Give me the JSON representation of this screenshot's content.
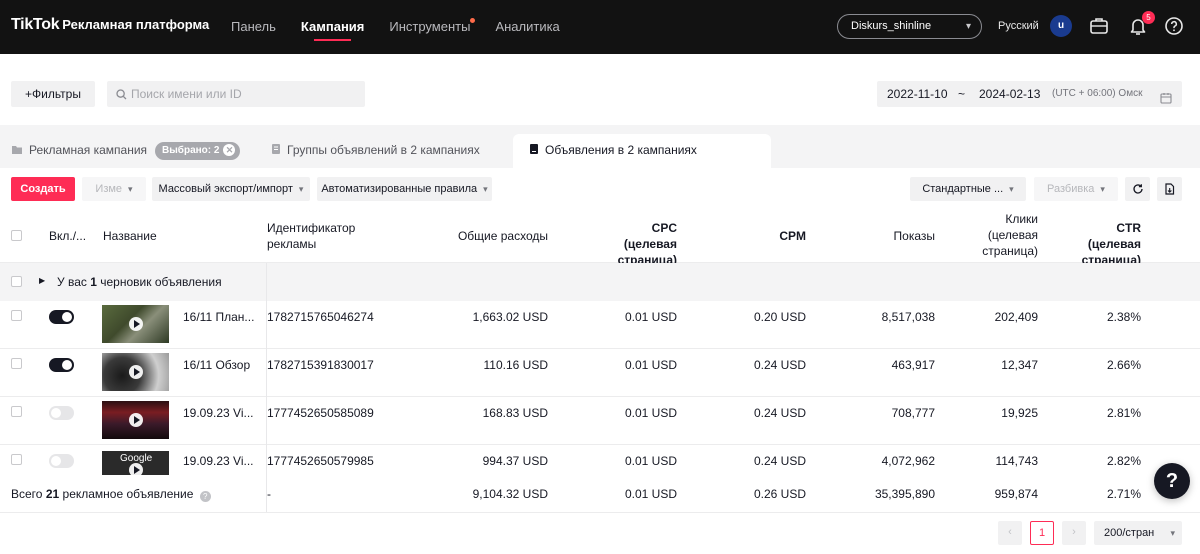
{
  "header": {
    "logo": "TikTok",
    "platform": "Рекламная платформа",
    "nav": [
      {
        "label": "Панель"
      },
      {
        "label": "Кампания"
      },
      {
        "label": "Инструменты"
      },
      {
        "label": "Аналитика"
      }
    ],
    "active_nav": "Кампания",
    "account": "Diskurs_shinline",
    "language": "Русский",
    "avatar_letter": "u",
    "notifications_count": "5"
  },
  "filters": {
    "filter_label": "+Фильтры",
    "search_placeholder": "Поиск имени или ID",
    "date_start": "2022-11-10",
    "date_sep": "~",
    "date_end": "2024-02-13",
    "timezone": "(UTC + 06:00) Омск"
  },
  "tabs": {
    "campaigns": "Рекламная кампания",
    "selected_pill": "Выбрано: 2",
    "ad_groups": "Группы объявлений в 2 кампаниях",
    "ads": "Объявления в 2 кампаниях"
  },
  "toolbar": {
    "create": "Создать",
    "edit": "Изме",
    "bulk_export": "Массовый экспорт/импорт",
    "automated_rules": "Автоматизированные правила",
    "standard": "Стандартные ...",
    "breakdown": "Разбивка"
  },
  "table": {
    "headers": {
      "on_off": "Вкл./...",
      "name": "Название",
      "ad_id": "Идентификатор рекламы",
      "spend": "Общие расходы",
      "cpc": "CPC (целевая страница)",
      "cpm": "CPM",
      "impressions": "Показы",
      "clicks": "Клики (целевая страница)",
      "ctr": "CTR (целевая страница)"
    },
    "draft_prefix": "У вас",
    "draft_count": "1",
    "draft_suffix": "черновик объявления",
    "rows": [
      {
        "enabled": true,
        "name": "16/11 План...",
        "id": "1782715765046274",
        "spend": "1,663.02 USD",
        "cpc": "0.01 USD",
        "cpm": "0.20 USD",
        "impressions": "8,517,038",
        "clicks": "202,409",
        "ctr": "2.38%"
      },
      {
        "enabled": true,
        "name": "16/11 Обзор",
        "id": "1782715391830017",
        "spend": "110.16 USD",
        "cpc": "0.01 USD",
        "cpm": "0.24 USD",
        "impressions": "463,917",
        "clicks": "12,347",
        "ctr": "2.66%"
      },
      {
        "enabled": false,
        "name": "19.09.23 Vi...",
        "id": "1777452650585089",
        "spend": "168.83 USD",
        "cpc": "0.01 USD",
        "cpm": "0.24 USD",
        "impressions": "708,777",
        "clicks": "19,925",
        "ctr": "2.81%"
      },
      {
        "enabled": false,
        "name": "19.09.23 Vi...",
        "id": "1777452650579985",
        "spend": "994.37 USD",
        "cpc": "0.01 USD",
        "cpm": "0.24 USD",
        "impressions": "4,072,962",
        "clicks": "114,743",
        "ctr": "2.82%",
        "thumb_text": "Google"
      }
    ],
    "total": {
      "prefix": "Всего",
      "count": "21",
      "suffix": "рекламное объявление",
      "id": "-",
      "spend": "9,104.32 USD",
      "cpc": "0.01 USD",
      "cpm": "0.26 USD",
      "impressions": "35,395,890",
      "clicks": "959,874",
      "ctr": "2.71%"
    }
  },
  "pagination": {
    "current_page": "1",
    "page_size": "200/стран"
  },
  "help_fab": "?",
  "colors": {
    "accent": "#fe2c55",
    "topbar": "#121212"
  }
}
